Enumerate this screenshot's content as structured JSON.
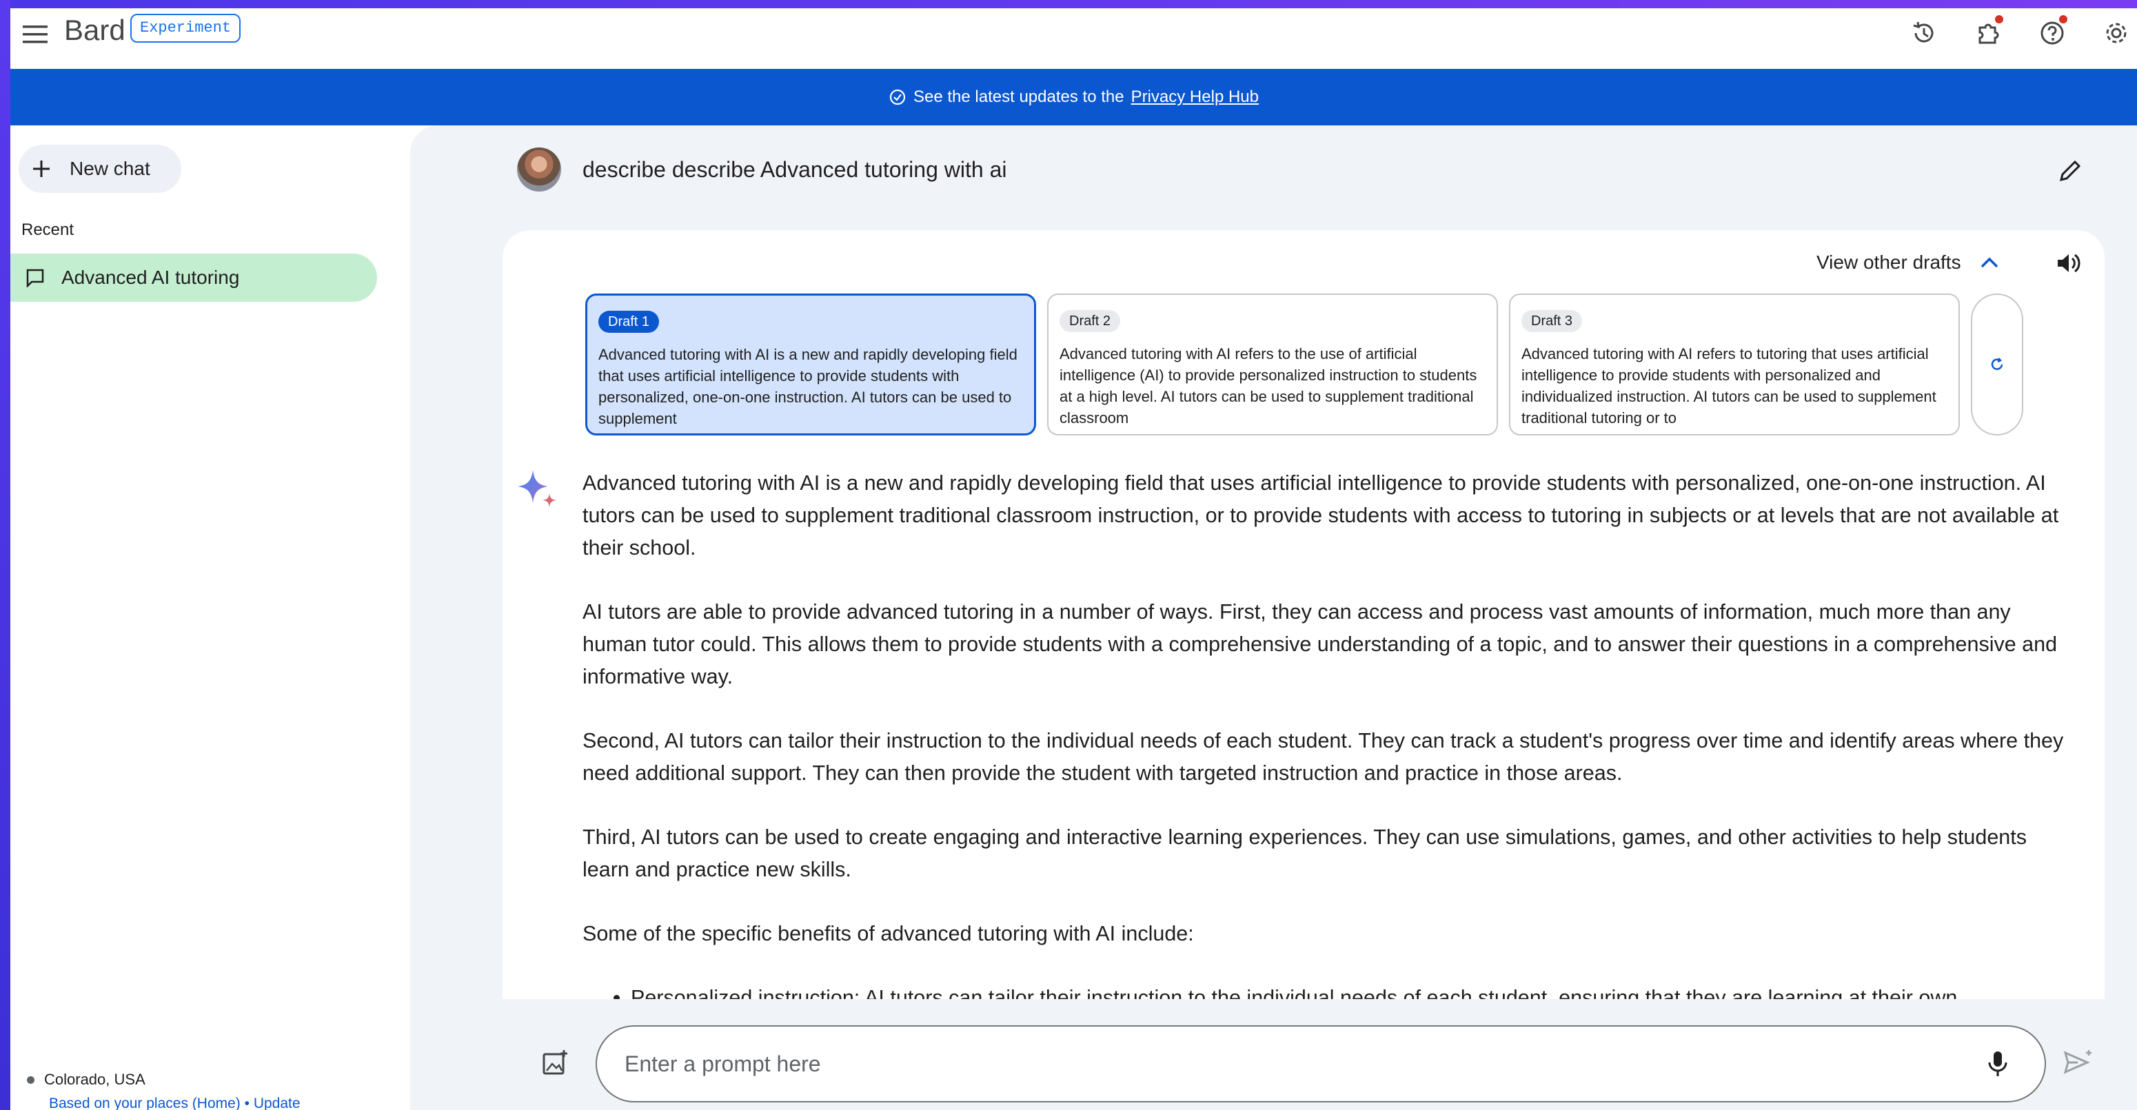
{
  "app": {
    "brand": "Bard",
    "badge": "Experiment"
  },
  "toolbar": {
    "icons": [
      "menu-icon",
      "history-icon",
      "extensions-icon",
      "help-icon",
      "settings-icon"
    ]
  },
  "banner": {
    "text": "See the latest updates to the",
    "link": "Privacy Help Hub"
  },
  "sidebar": {
    "new_chat": "New chat",
    "recent_label": "Recent",
    "items": [
      {
        "label": "Advanced AI tutoring",
        "active": true
      }
    ],
    "location": "Colorado, USA",
    "location_sub": "Based on your places (Home) • Update"
  },
  "conversation": {
    "query": "describe describe Advanced tutoring with ai",
    "view_drafts_label": "View other drafts",
    "drafts": [
      {
        "label": "Draft 1",
        "text": "Advanced tutoring with AI is a new and rapidly developing field that uses artificial intelligence to provide students with personalized, one-on-one instruction. AI tutors can be used to supplement",
        "selected": true
      },
      {
        "label": "Draft 2",
        "text": "Advanced tutoring with AI refers to the use of artificial intelligence (AI) to provide personalized instruction to students at a high level. AI tutors can be used to supplement traditional classroom",
        "selected": false
      },
      {
        "label": "Draft 3",
        "text": "Advanced tutoring with AI refers to tutoring that uses artificial intelligence to provide students with personalized and individualized instruction. AI tutors can be used to supplement traditional tutoring or to",
        "selected": false
      }
    ],
    "paragraphs": [
      "Advanced tutoring with AI is a new and rapidly developing field that uses artificial intelligence to provide students with personalized, one-on-one instruction. AI tutors can be used to supplement traditional classroom instruction, or to provide students with access to tutoring in subjects or at levels that are not available at their school.",
      "AI tutors are able to provide advanced tutoring in a number of ways. First, they can access and process vast amounts of information, much more than any human tutor could. This allows them to provide students with a comprehensive understanding of a topic, and to answer their questions in a comprehensive and informative way.",
      "Second, AI tutors can tailor their instruction to the individual needs of each student. They can track a student's progress over time and identify areas where they need additional support. They can then provide the student with targeted instruction and practice in those areas.",
      "Third, AI tutors can be used to create engaging and interactive learning experiences. They can use simulations, games, and other activities to help students learn and practice new skills.",
      "Some of the specific benefits of advanced tutoring with AI include:"
    ],
    "bullets": [
      "Personalized instruction: AI tutors can tailor their instruction to the individual needs of each student, ensuring that they are learning at their own"
    ]
  },
  "prompt": {
    "placeholder": "Enter a prompt here"
  },
  "colors": {
    "banner": "#0b57d0",
    "active_chat": "#c4eed0",
    "selected_draft": "#d3e3fd",
    "main_bg": "#f0f4f9"
  }
}
